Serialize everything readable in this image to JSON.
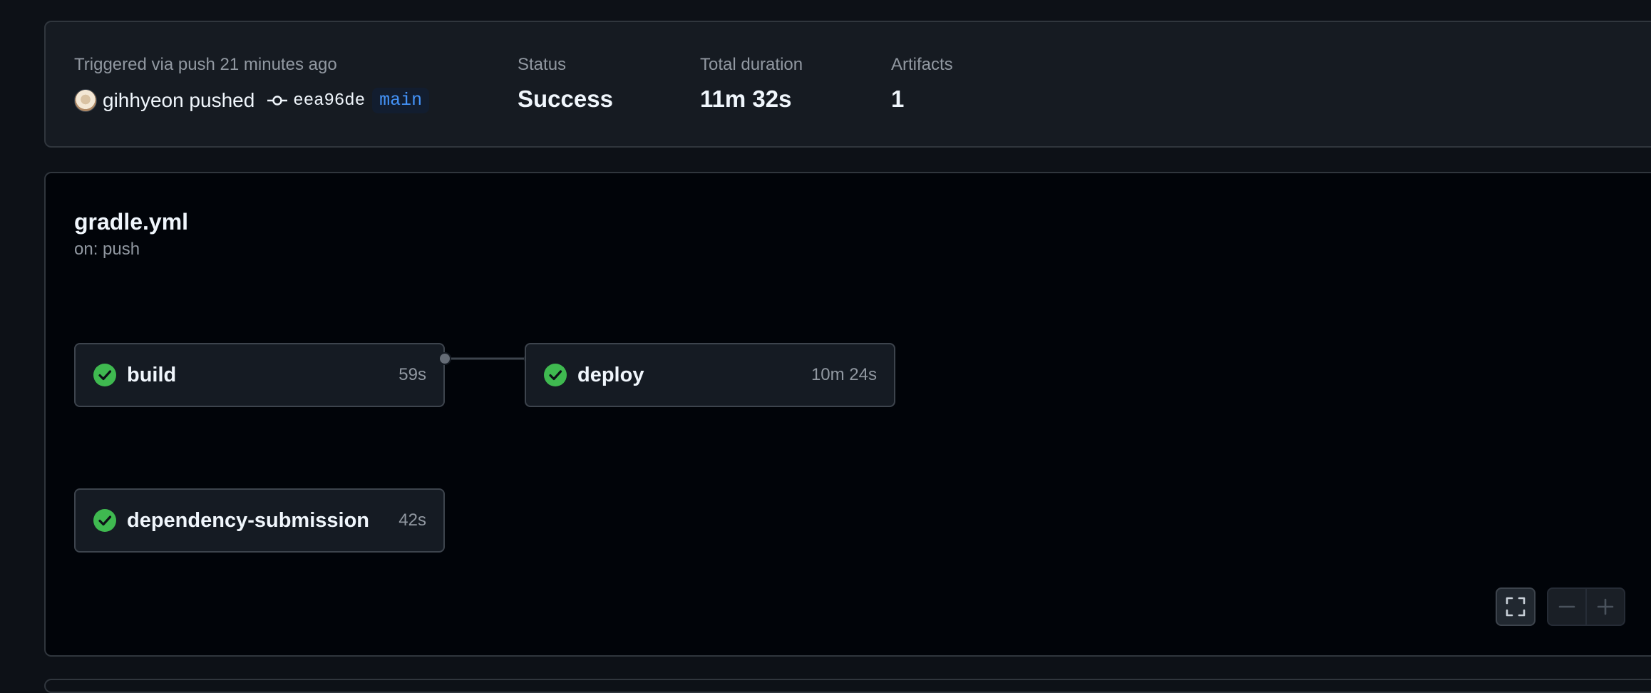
{
  "summary": {
    "trigger_text": "Triggered via push 21 minutes ago",
    "actor": "gihhyeon pushed",
    "commit_sha": "eea96de",
    "branch": "main",
    "status_label": "Status",
    "status_value": "Success",
    "duration_label": "Total duration",
    "duration_value": "11m 32s",
    "artifacts_label": "Artifacts",
    "artifacts_value": "1"
  },
  "workflow": {
    "file": "gradle.yml",
    "trigger": "on: push",
    "jobs": [
      {
        "name": "build",
        "duration": "59s",
        "status": "success"
      },
      {
        "name": "deploy",
        "duration": "10m 24s",
        "status": "success"
      },
      {
        "name": "dependency-submission",
        "duration": "42s",
        "status": "success"
      }
    ],
    "dependencies": [
      {
        "from": "build",
        "to": "deploy"
      }
    ]
  },
  "controls": {
    "fullscreen_icon": "fullscreen-icon",
    "zoom_out_icon": "zoom-out-icon",
    "zoom_in_icon": "zoom-in-icon"
  },
  "colors": {
    "success": "#3fb950",
    "branch_text": "#4493f8",
    "background": "#0d1117"
  }
}
